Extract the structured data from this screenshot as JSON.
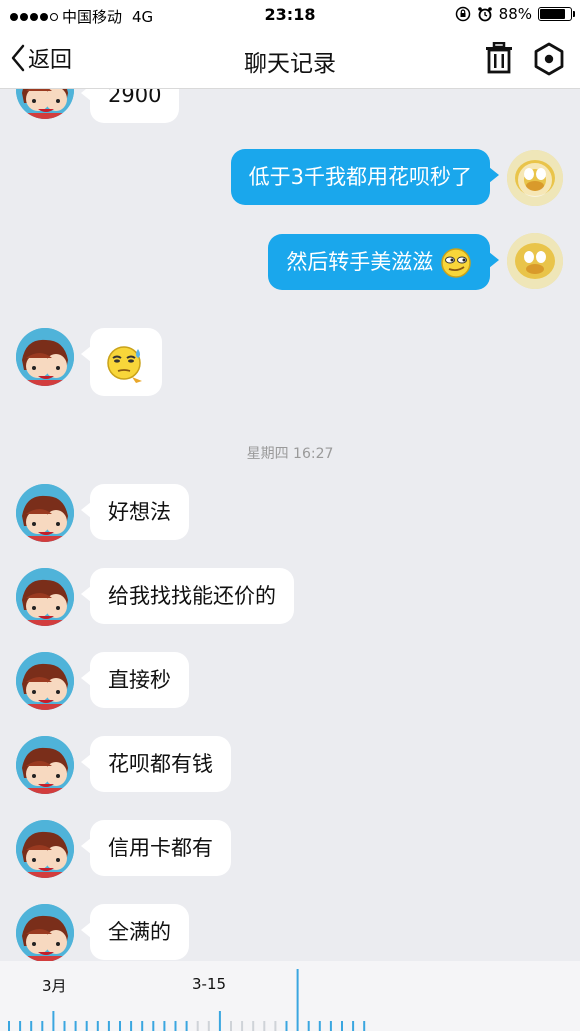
{
  "status_bar": {
    "carrier": "中国移动",
    "network": "4G",
    "time": "23:18",
    "battery_text": "88%",
    "battery_level": 0.88
  },
  "nav": {
    "back_label": "返回",
    "title": "聊天记录"
  },
  "messages": {
    "partial_top": "2900",
    "m1": "低于3千我都用花呗秒了",
    "m2": "然后转手美滋滋",
    "divider": "星期四 16:27",
    "m3": "好想法",
    "m4": "给我找找能还价的",
    "m5": "直接秒",
    "m6": "花呗都有钱",
    "m7": "信用卡都有",
    "m8": "全满的"
  },
  "timeline": {
    "label_month": "3月",
    "label_date": "3-15"
  },
  "colors": {
    "accent": "#1aa7ec",
    "background": "#ebecf0",
    "bubble_left": "#ffffff"
  }
}
